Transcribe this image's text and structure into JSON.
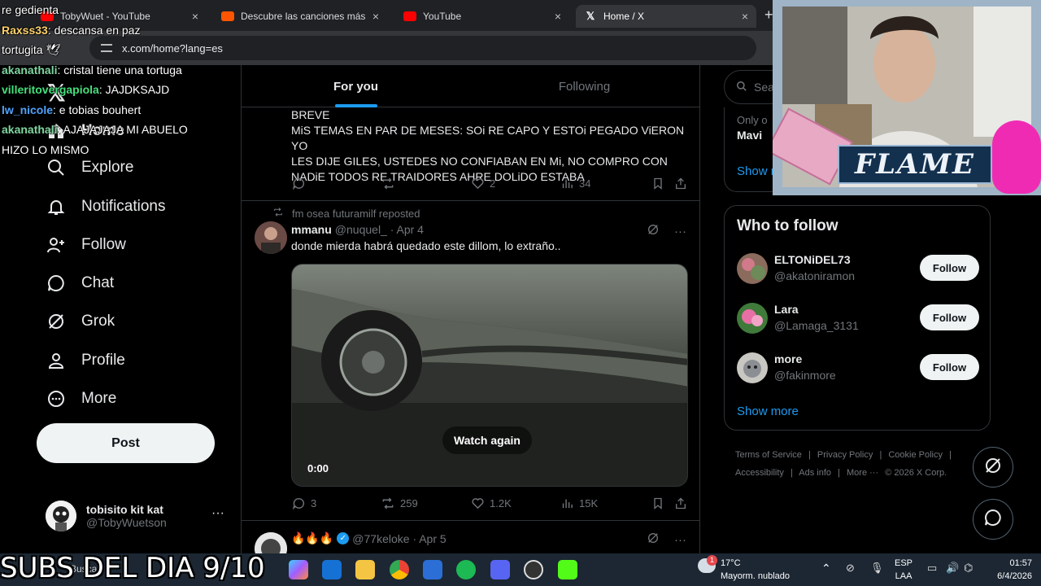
{
  "browser": {
    "tabs": [
      {
        "label": "TobyWuet - YouTube",
        "icon": "youtube-icon",
        "color": "#ff0000"
      },
      {
        "label": "Descubre las canciones más esc",
        "icon": "soundcloud-icon",
        "color": "#ff5500"
      },
      {
        "label": "YouTube",
        "icon": "youtube-icon",
        "color": "#ff0000"
      },
      {
        "label": "Home / X",
        "icon": "x-icon",
        "color": "#ffffff"
      }
    ],
    "url": "x.com/home?lang=es",
    "close_glyph": "×",
    "new_tab_glyph": "+"
  },
  "nav": {
    "items": [
      {
        "label": "Home",
        "icon": "home-icon"
      },
      {
        "label": "Explore",
        "icon": "search-icon"
      },
      {
        "label": "Notifications",
        "icon": "bell-icon"
      },
      {
        "label": "Follow",
        "icon": "add-user-icon"
      },
      {
        "label": "Chat",
        "icon": "chat-icon"
      },
      {
        "label": "Grok",
        "icon": "grok-icon"
      },
      {
        "label": "Profile",
        "icon": "person-icon"
      },
      {
        "label": "More",
        "icon": "more-circle-icon"
      }
    ],
    "post_label": "Post",
    "account": {
      "name": "tobisito kit kat",
      "handle": "@TobyWuetson",
      "more": "···"
    }
  },
  "feed": {
    "tabs": [
      "For you",
      "Following"
    ],
    "tweet1": {
      "text_lines": [
        "BREVE",
        "MiS TEMAS EN PAR DE MESES: SOi RE CAPO Y ESTOi PEGADO ViERON YO",
        "LES DIJE GILES, USTEDES NO CONFIABAN EN Mi, NO COMPRO CON",
        "NADiE TODOS RE TRAIDORES AHRE DOLiDO ESTABA"
      ],
      "replies": "",
      "reposts": "",
      "likes": "2",
      "views": "34"
    },
    "tweet2": {
      "repost_by": "fm osea futuramilf reposted",
      "name": "mmanu",
      "handle": "@nuquel_ · Apr 4",
      "text": "donde mierda habrá quedado este dillom, lo extraño..",
      "video_overlay": "Watch again",
      "video_time": "0:00",
      "replies": "3",
      "reposts": "259",
      "likes": "1.2K",
      "views": "15K"
    },
    "tweet3": {
      "name": "🔥🔥🔥",
      "handle": "@77keloke · Apr 5"
    },
    "more_glyph": "···"
  },
  "right": {
    "search_placeholder": "Sear",
    "card_top": {
      "line1": "Only o",
      "line2": "Mavi",
      "show_more": "Show r"
    },
    "who_to_follow": {
      "title": "Who to follow",
      "users": [
        {
          "name": "ELTONiDEL73",
          "handle": "@akatoniramon",
          "button": "Follow"
        },
        {
          "name": "Lara",
          "handle": "@Lamaga_3131",
          "button": "Follow"
        },
        {
          "name": "more",
          "handle": "@fakinmore",
          "button": "Follow"
        }
      ],
      "show_more": "Show more"
    },
    "footer": [
      "Terms of Service",
      "|",
      "Privacy Policy",
      "|",
      "Cookie Policy",
      "|",
      "Accessibility",
      "|",
      "Ads info",
      "|",
      "More ···",
      "© 2026 X Corp."
    ]
  },
  "overlay": {
    "chat": [
      {
        "user": "",
        "msg": "re gedienta",
        "cls": ""
      },
      {
        "user": "Raxss33",
        "msg": ": descansa en paz",
        "cls": "u2"
      },
      {
        "user": "",
        "msg": "tortugita 🕊",
        "cls": ""
      },
      {
        "user": "akanathali",
        "msg": ": cristal tiene una tortuga",
        "cls": "u1"
      },
      {
        "user": "villeritovergapiola",
        "msg": ": JAJDKSAJD",
        "cls": "u3"
      },
      {
        "user": "lw_nicole",
        "msg": ": e tobias bouhert",
        "cls": "u4"
      },
      {
        "user": "akanathali",
        "msg": ": AJAJAJAJA MI ABUELO",
        "cls": "u1"
      },
      {
        "user": "",
        "msg": "HIZO LO MISMO",
        "cls": ""
      }
    ],
    "webcam_banner": "FLAME",
    "subs_text": "SUBS DEL DIA 9/10"
  },
  "taskbar": {
    "weather_temp": "17°C",
    "weather_desc": "Mayorm. nublado",
    "lang1": "ESP",
    "lang2": "LAA",
    "time": "01:57",
    "date": "6/4/2026",
    "search": "Buscar",
    "badge": "1"
  }
}
